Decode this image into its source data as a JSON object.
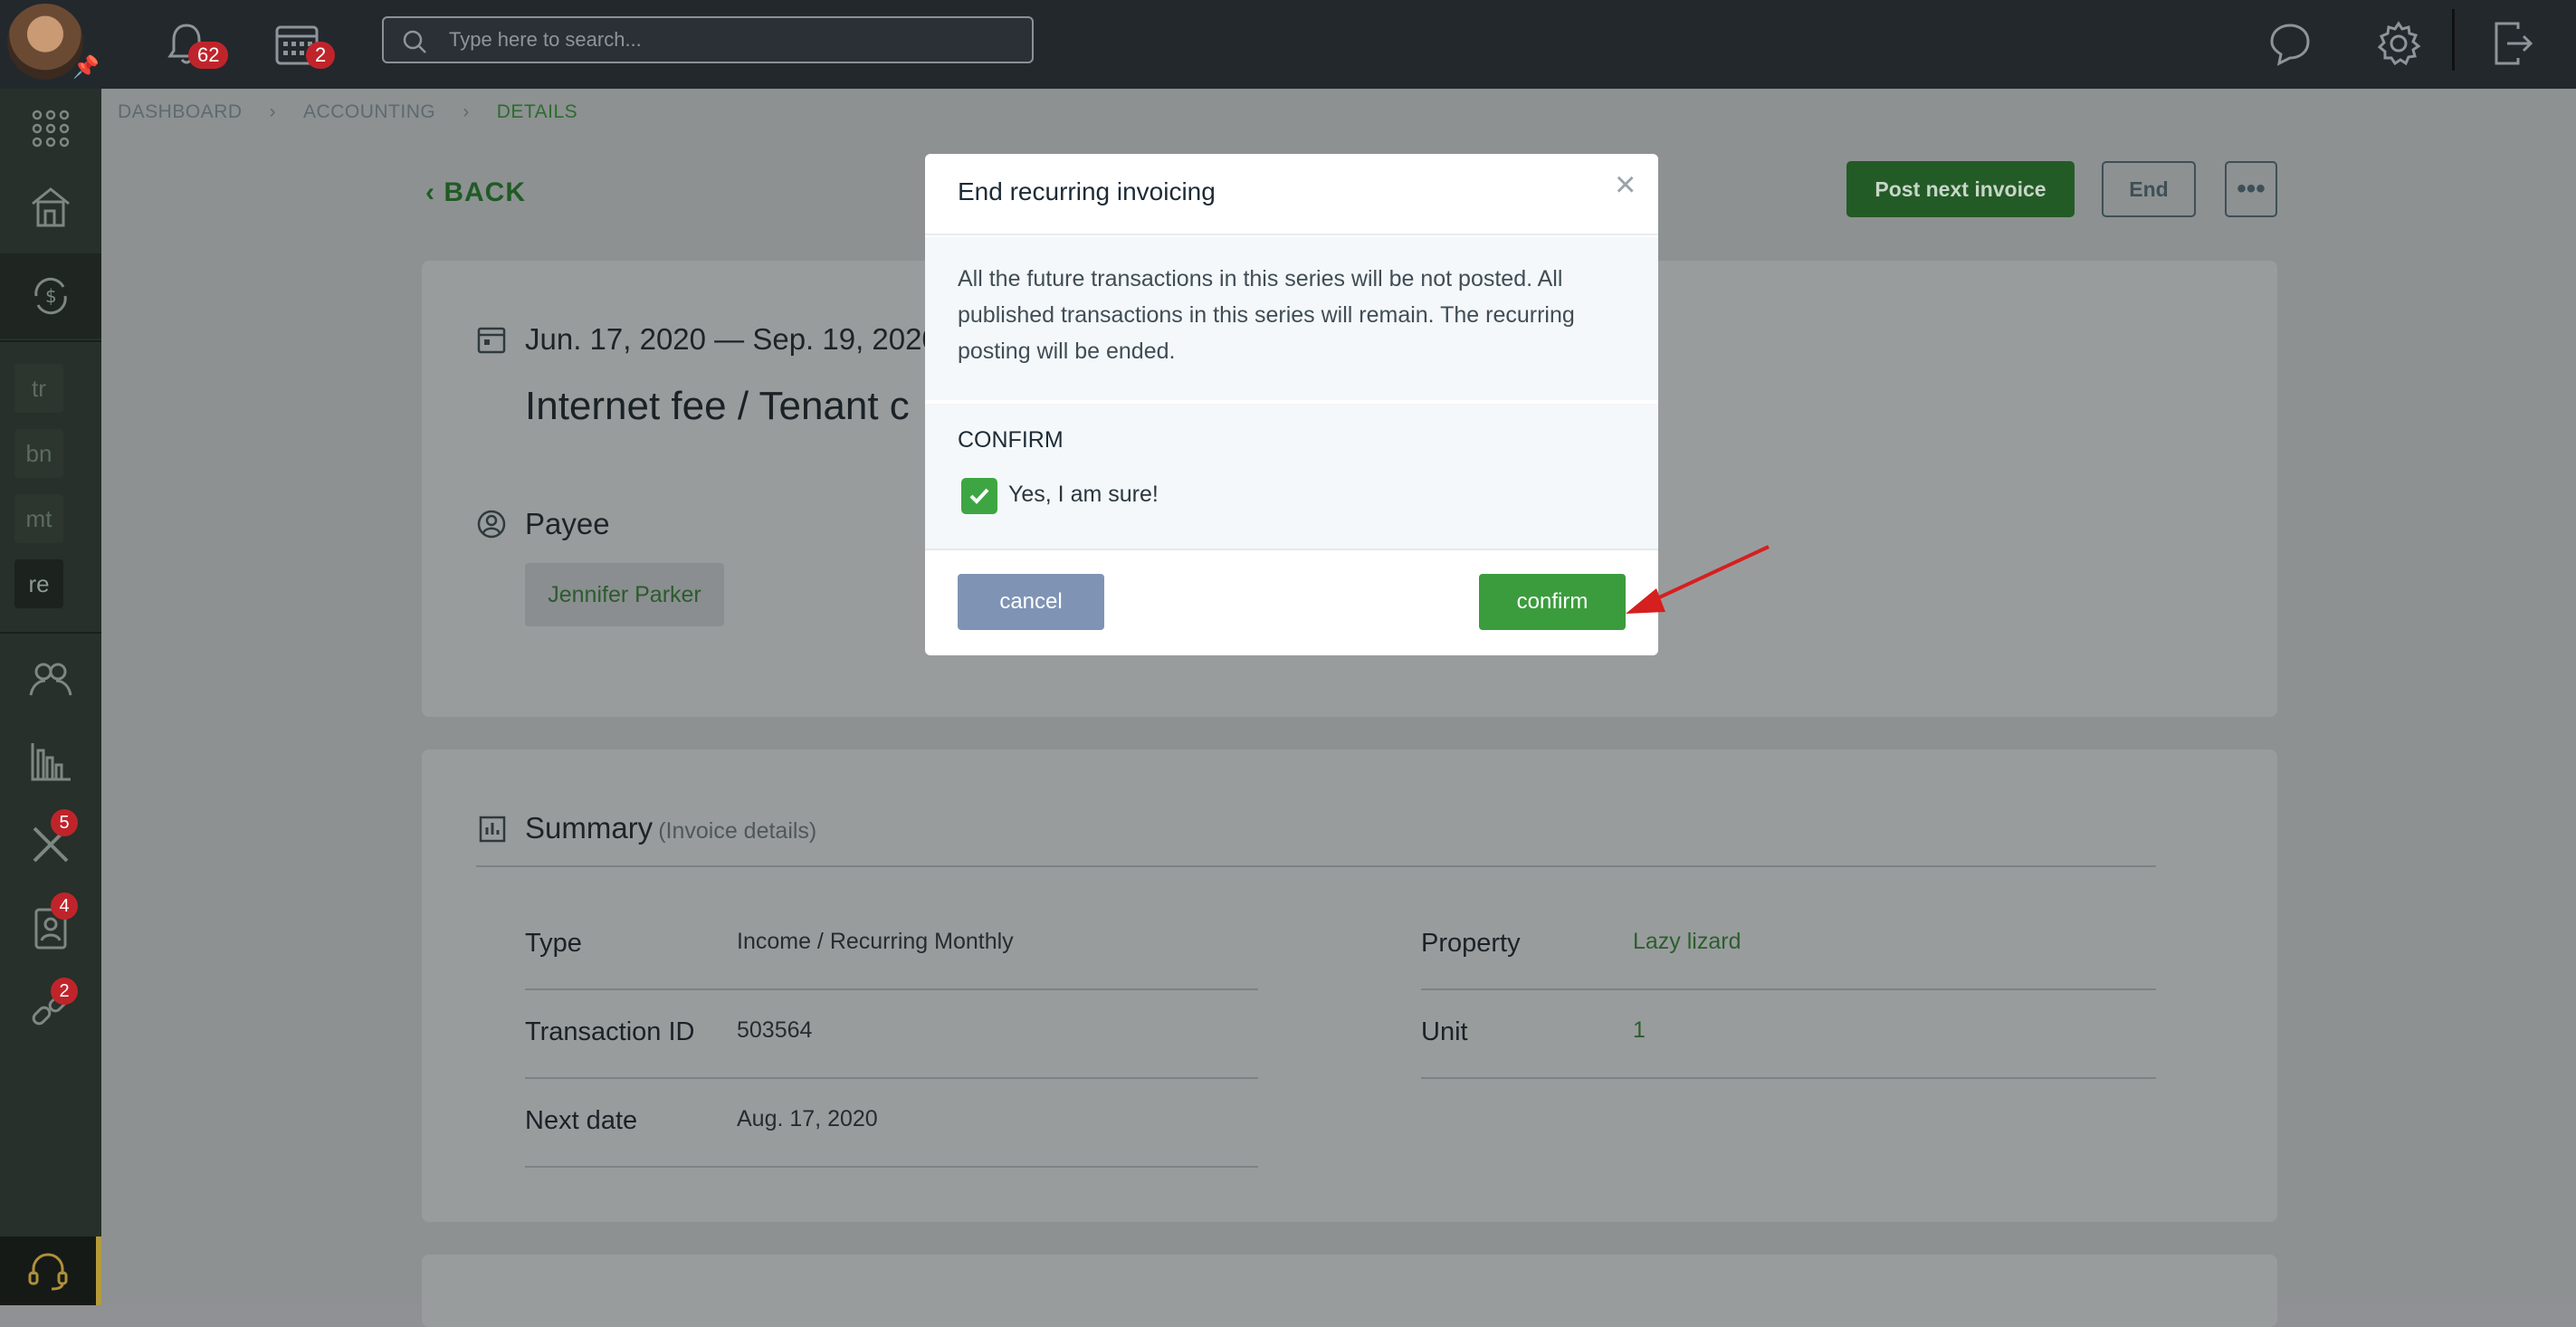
{
  "topbar": {
    "notifications_count": "62",
    "calendar_count": "2",
    "search_placeholder": "Type here to search..."
  },
  "sidebar": {
    "tags": [
      "tr",
      "bn",
      "mt",
      "re"
    ],
    "maintenance_badge": "5",
    "contacts_badge": "4",
    "tools_badge": "2"
  },
  "breadcrumb": [
    "DASHBOARD",
    "ACCOUNTING",
    "DETAILS"
  ],
  "header": {
    "back_label": "BACK",
    "post_next_label": "Post next invoice",
    "end_label": "End",
    "more_label": "•••"
  },
  "details": {
    "date_range": "Jun. 17, 2020 — Sep. 19, 2020",
    "title": "Internet fee / Tenant c",
    "payee_label": "Payee",
    "payee_name": "Jennifer Parker"
  },
  "summary": {
    "title": "Summary",
    "subtitle": "(Invoice details)",
    "rows_left": [
      {
        "label": "Type",
        "value": "Income / Recurring Monthly"
      },
      {
        "label": "Transaction ID",
        "value": "503564"
      },
      {
        "label": "Next date",
        "value": "Aug. 17, 2020"
      }
    ],
    "rows_right": [
      {
        "label": "Property",
        "value": "Lazy lizard"
      },
      {
        "label": "Unit",
        "value": "1"
      }
    ]
  },
  "modal": {
    "title": "End recurring invoicing",
    "close_label": "×",
    "message": "All the future transactions in this series will be not posted. All published transactions in this series will remain. The recurring posting will be ended.",
    "confirm_heading": "CONFIRM",
    "checkbox_label": "Yes, I am sure!",
    "checkbox_checked": true,
    "cancel_label": "cancel",
    "confirm_label": "confirm"
  },
  "colors": {
    "accent_green": "#3b9c3d",
    "cancel_blue": "#7f93b5",
    "badge_red": "#c0242b",
    "annotation_arrow": "#d61f1f"
  }
}
